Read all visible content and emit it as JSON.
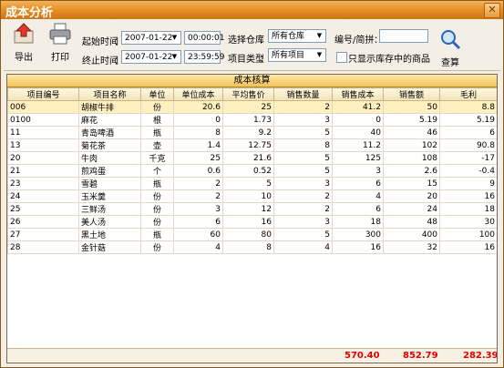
{
  "window": {
    "title": "成本分析"
  },
  "toolbar": {
    "export_label": "导出",
    "print_label": "打印",
    "search_label": "查算"
  },
  "filters": {
    "start_label": "起始时间",
    "start_date": "2007-01-22",
    "start_time": "00:00:01",
    "end_label": "终止时间",
    "end_date": "2007-01-22",
    "end_time": "23:59:59",
    "warehouse_label": "选择仓库",
    "warehouse_value": "所有仓库",
    "category_label": "项目类型",
    "category_value": "所有项目",
    "code_label": "编号/简拼",
    "code_value": "",
    "instock_label": "只显示库存中的商品"
  },
  "table": {
    "caption": "成本核算",
    "columns": [
      "项目编号",
      "项目名称",
      "单位",
      "单位成本",
      "平均售价",
      "销售数量",
      "销售成本",
      "销售额",
      "毛利"
    ],
    "rows": [
      [
        "006",
        "胡椒牛排",
        "份",
        "20.6",
        "25",
        "2",
        "41.2",
        "50",
        "8.8"
      ],
      [
        "0100",
        "麻花",
        "根",
        "0",
        "1.73",
        "3",
        "0",
        "5.19",
        "5.19"
      ],
      [
        "11",
        "青岛啤酒",
        "瓶",
        "8",
        "9.2",
        "5",
        "40",
        "46",
        "6"
      ],
      [
        "13",
        "菊花茶",
        "壶",
        "1.4",
        "12.75",
        "8",
        "11.2",
        "102",
        "90.8"
      ],
      [
        "20",
        "牛肉",
        "千克",
        "25",
        "21.6",
        "5",
        "125",
        "108",
        "-17"
      ],
      [
        "21",
        "煎鸡蛋",
        "个",
        "0.6",
        "0.52",
        "5",
        "3",
        "2.6",
        "-0.4"
      ],
      [
        "23",
        "雪碧",
        "瓶",
        "2",
        "5",
        "3",
        "6",
        "15",
        "9"
      ],
      [
        "24",
        "玉米羹",
        "份",
        "2",
        "10",
        "2",
        "4",
        "20",
        "16"
      ],
      [
        "25",
        "三鲜汤",
        "份",
        "3",
        "12",
        "2",
        "6",
        "24",
        "18"
      ],
      [
        "26",
        "美人汤",
        "份",
        "6",
        "16",
        "3",
        "18",
        "48",
        "30"
      ],
      [
        "27",
        "黑土地",
        "瓶",
        "60",
        "80",
        "5",
        "300",
        "400",
        "100"
      ],
      [
        "28",
        "金针菇",
        "份",
        "4",
        "8",
        "4",
        "16",
        "32",
        "16"
      ]
    ],
    "totals": {
      "cost": "570.40",
      "sales": "852.79",
      "profit": "282.39"
    }
  }
}
